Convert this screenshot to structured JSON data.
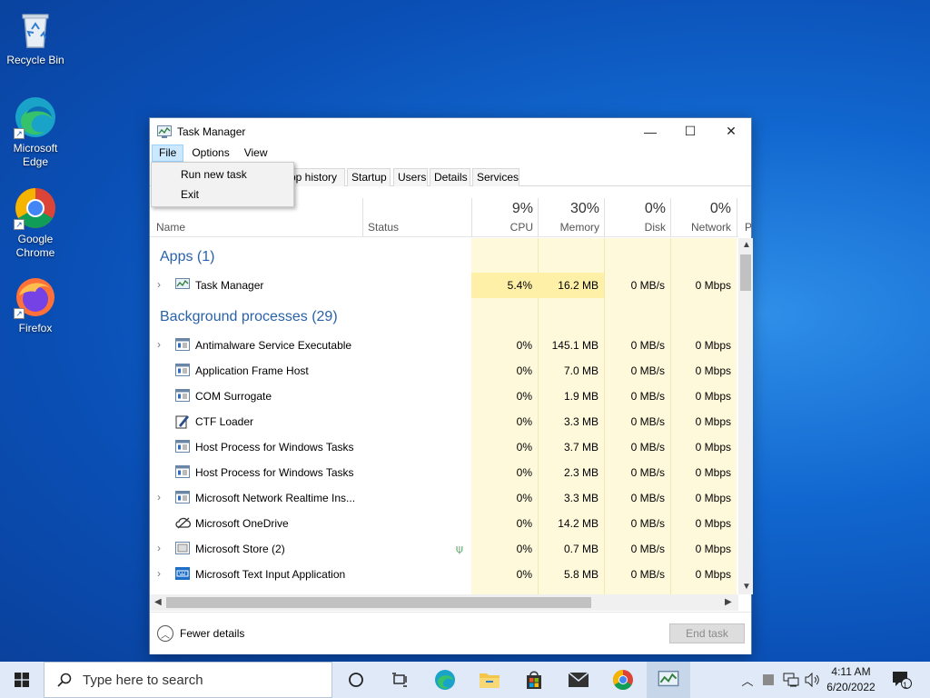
{
  "desktop": {
    "icons": [
      {
        "label": "Recycle Bin",
        "icon": "recycle-bin-icon"
      },
      {
        "label": "Microsoft Edge",
        "icon": "edge-icon"
      },
      {
        "label": "Google Chrome",
        "icon": "chrome-icon"
      },
      {
        "label": "Firefox",
        "icon": "firefox-icon"
      }
    ]
  },
  "window": {
    "title": "Task Manager",
    "controls": {
      "minimize": "—",
      "maximize": "☐",
      "close": "✕"
    },
    "menu": [
      "File",
      "Options",
      "View"
    ],
    "file_menu": [
      "Run new task",
      "Exit"
    ],
    "tabs": [
      "pp history",
      "Startup",
      "Users",
      "Details",
      "Services"
    ],
    "columns": {
      "name": "Name",
      "status": "Status",
      "cpu": {
        "pct": "9%",
        "label": "CPU"
      },
      "memory": {
        "pct": "30%",
        "label": "Memory"
      },
      "disk": {
        "pct": "0%",
        "label": "Disk"
      },
      "network": {
        "pct": "0%",
        "label": "Network"
      },
      "power_partial": "P"
    },
    "groups": {
      "apps": "Apps (1)",
      "background": "Background processes (29)"
    },
    "apps": [
      {
        "name": "Task Manager",
        "cpu": "5.4%",
        "memory": "16.2 MB",
        "disk": "0 MB/s",
        "network": "0 Mbps",
        "expand": true,
        "icon": "task-manager-icon"
      }
    ],
    "processes": [
      {
        "name": "Antimalware Service Executable",
        "cpu": "0%",
        "memory": "145.1 MB",
        "disk": "0 MB/s",
        "network": "0 Mbps",
        "expand": true,
        "icon": "service-icon"
      },
      {
        "name": "Application Frame Host",
        "cpu": "0%",
        "memory": "7.0 MB",
        "disk": "0 MB/s",
        "network": "0 Mbps",
        "expand": false,
        "icon": "service-icon"
      },
      {
        "name": "COM Surrogate",
        "cpu": "0%",
        "memory": "1.9 MB",
        "disk": "0 MB/s",
        "network": "0 Mbps",
        "expand": false,
        "icon": "service-icon"
      },
      {
        "name": "CTF Loader",
        "cpu": "0%",
        "memory": "3.3 MB",
        "disk": "0 MB/s",
        "network": "0 Mbps",
        "expand": false,
        "icon": "ctf-icon"
      },
      {
        "name": "Host Process for Windows Tasks",
        "cpu": "0%",
        "memory": "3.7 MB",
        "disk": "0 MB/s",
        "network": "0 Mbps",
        "expand": false,
        "icon": "service-icon"
      },
      {
        "name": "Host Process for Windows Tasks",
        "cpu": "0%",
        "memory": "2.3 MB",
        "disk": "0 MB/s",
        "network": "0 Mbps",
        "expand": false,
        "icon": "service-icon"
      },
      {
        "name": "Microsoft Network Realtime Ins...",
        "cpu": "0%",
        "memory": "3.3 MB",
        "disk": "0 MB/s",
        "network": "0 Mbps",
        "expand": true,
        "icon": "service-icon"
      },
      {
        "name": "Microsoft OneDrive",
        "cpu": "0%",
        "memory": "14.2 MB",
        "disk": "0 MB/s",
        "network": "0 Mbps",
        "expand": false,
        "icon": "onedrive-icon"
      },
      {
        "name": "Microsoft Store (2)",
        "cpu": "0%",
        "memory": "0.7 MB",
        "disk": "0 MB/s",
        "network": "0 Mbps",
        "expand": true,
        "icon": "store-icon",
        "suspended": true
      },
      {
        "name": "Microsoft Text Input Application",
        "cpu": "0%",
        "memory": "5.8 MB",
        "disk": "0 MB/s",
        "network": "0 Mbps",
        "expand": true,
        "icon": "keyboard-icon"
      }
    ],
    "footer": {
      "fewer_details": "Fewer details",
      "end_task": "End task"
    }
  },
  "taskbar": {
    "search_placeholder": "Type here to search",
    "time": "4:11 AM",
    "date": "6/20/2022",
    "notification_count": "1"
  },
  "colors": {
    "heat_light": "#fff9dc",
    "heat_strong": "#fff0a8",
    "group_text": "#2a62a8",
    "taskbar": "#dfe9f7"
  }
}
